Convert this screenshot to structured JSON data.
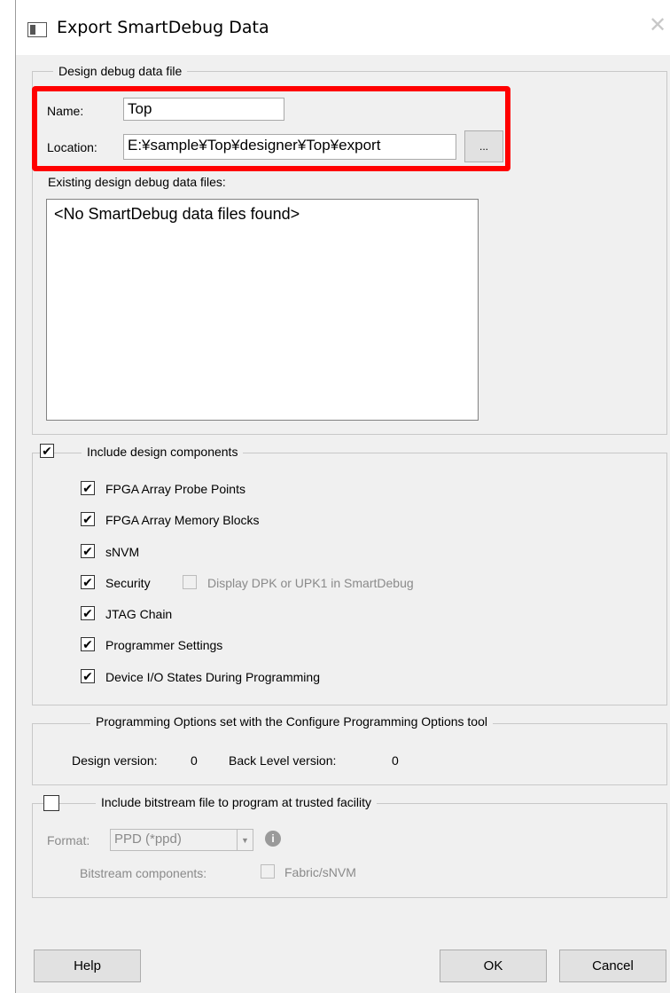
{
  "window": {
    "title": "Export SmartDebug Data",
    "close_glyph": "✕"
  },
  "design_debug": {
    "group_label": "Design debug data file",
    "name_label": "Name:",
    "name_value": "Top",
    "location_label": "Location:",
    "location_value": "E:¥sample¥Top¥designer¥Top¥export",
    "browse_label": "...",
    "existing_label": "Existing design debug data files:",
    "existing_empty": "<No SmartDebug data files found>"
  },
  "components": {
    "group_label": "Include design components",
    "checked": true,
    "items": [
      {
        "label": "FPGA Array Probe Points",
        "checked": true
      },
      {
        "label": "FPGA Array Memory Blocks",
        "checked": true
      },
      {
        "label": "sNVM",
        "checked": true
      },
      {
        "label": "Security",
        "checked": true
      },
      {
        "label": "JTAG Chain",
        "checked": true
      },
      {
        "label": "Programmer Settings",
        "checked": true
      },
      {
        "label": "Device I/O States During Programming",
        "checked": true
      }
    ],
    "security_sub": {
      "label": "Display DPK or UPK1 in SmartDebug",
      "checked": false
    }
  },
  "programming_options": {
    "group_label": "Programming Options set with the Configure Programming Options tool",
    "design_version_label": "Design version:",
    "design_version_value": "0",
    "back_level_label": "Back Level version:",
    "back_level_value": "0"
  },
  "bitstream": {
    "group_label": "Include bitstream file to program at trusted facility",
    "checked": false,
    "format_label": "Format:",
    "format_value": "PPD (*ppd)",
    "components_label": "Bitstream components:",
    "fabric_label": "Fabric/sNVM",
    "fabric_checked": false
  },
  "buttons": {
    "help": "Help",
    "ok": "OK",
    "cancel": "Cancel"
  },
  "colors": {
    "highlight": "#ff0000",
    "dialog_bg": "#f0f0f0"
  },
  "icons": {
    "window_icon": "app-window-icon",
    "checkmark": "✔",
    "info": "info-icon",
    "dropdown": "chevron-down-icon"
  }
}
